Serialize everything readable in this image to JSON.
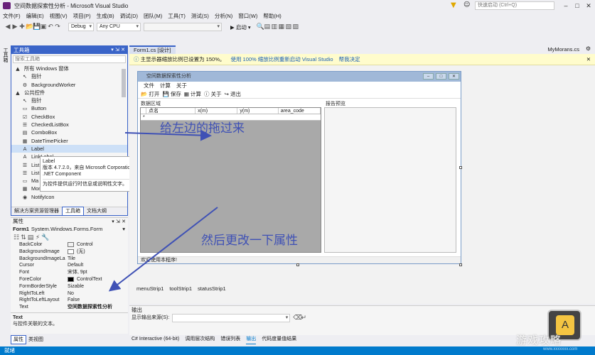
{
  "window": {
    "title": "空间数据探索性分析 - Microsoft Visual Studio",
    "quick_launch_placeholder": "快速启动 (Ctrl+Q)",
    "user": "MyMorans.cs"
  },
  "menu": [
    "文件(F)",
    "编辑(E)",
    "视图(V)",
    "项目(P)",
    "生成(B)",
    "调试(D)",
    "团队(M)",
    "工具(T)",
    "测试(S)",
    "分析(N)",
    "窗口(W)",
    "帮助(H)"
  ],
  "toolbar": {
    "config": "Debug",
    "platform": "Any CPU",
    "start_label": "▶ 启动 ▾"
  },
  "side_strip": "工具箱",
  "toolbox": {
    "title": "工具箱",
    "search_placeholder": "搜索工具箱",
    "rows": [
      {
        "text": "所有 Windows 窗体",
        "type": "group",
        "icon": "▲"
      },
      {
        "text": "指针",
        "type": "item",
        "icon": "↖"
      },
      {
        "text": "BackgroundWorker",
        "type": "item",
        "icon": "⚙"
      },
      {
        "text": "公共控件",
        "type": "group",
        "icon": "▲"
      },
      {
        "text": "指针",
        "type": "item",
        "icon": "↖"
      },
      {
        "text": "Button",
        "type": "item",
        "icon": "▭"
      },
      {
        "text": "CheckBox",
        "type": "item",
        "icon": "☑"
      },
      {
        "text": "CheckedListBox",
        "type": "item",
        "icon": "☰"
      },
      {
        "text": "ComboBox",
        "type": "item",
        "icon": "▤"
      },
      {
        "text": "DateTimePicker",
        "type": "item",
        "icon": "▦"
      },
      {
        "text": "Label",
        "type": "item",
        "icon": "A",
        "selected": true
      },
      {
        "text": "LinkLabel",
        "type": "item",
        "icon": "A"
      },
      {
        "text": "List",
        "type": "item",
        "icon": "☰"
      },
      {
        "text": "List",
        "type": "item",
        "icon": "☰"
      },
      {
        "text": "Ma",
        "type": "item",
        "icon": "▭"
      },
      {
        "text": "MonthCalendar",
        "type": "item",
        "icon": "▦"
      },
      {
        "text": "NotifyIcon",
        "type": "item",
        "icon": "◉"
      }
    ],
    "tabs": [
      "解决方案资源管理器",
      "工具箱",
      "文档大纲"
    ]
  },
  "tooltip": {
    "title": "Label",
    "line1": "版本 4.7.2.0，来自 Microsoft Corporation",
    "line2": ".NET Component",
    "desc": "为控件提供运行时信息或说明性文字。"
  },
  "properties": {
    "header": "属性",
    "object": "Form1",
    "object_type": "System.Windows.Forms.Form",
    "rows": [
      {
        "k": "BackColor",
        "v": "Control",
        "swatch": "#f0f0f0"
      },
      {
        "k": "BackgroundImage",
        "v": "(无)",
        "swatch": "#ffffff"
      },
      {
        "k": "BackgroundImageLa",
        "v": "Tile"
      },
      {
        "k": "Cursor",
        "v": "Default"
      },
      {
        "k": "Font",
        "v": "宋体, 9pt"
      },
      {
        "k": "ForeColor",
        "v": "ControlText",
        "swatch": "#000000"
      },
      {
        "k": "FormBorderStyle",
        "v": "Sizable"
      },
      {
        "k": "RightToLeft",
        "v": "No"
      },
      {
        "k": "RightToLeftLayout",
        "v": "False"
      },
      {
        "k": "Text",
        "v": "空间数据探索性分析"
      }
    ],
    "desc_title": "Text",
    "desc": "与控件关联的文本。",
    "tabs": [
      "属性",
      "类视图"
    ]
  },
  "doc_tab": "Form1.cs [设计]",
  "infobar": {
    "message": "主显示器缩放比例已设置为 150%。",
    "link1": "使用 100% 缩放比例重新启动 Visual Studio",
    "link2": "帮我决定"
  },
  "form": {
    "title": "空间数据探索性分析",
    "menu": [
      "文件",
      "计算",
      "关于"
    ],
    "toolbar": [
      "📂 打开",
      "💾 保存",
      "▦ 计算",
      "ⓘ 关于",
      "↪ 退出"
    ],
    "data_group": "数据区域",
    "report_group": "报告预览",
    "columns": [
      "点名",
      "x(m)",
      "y(m)",
      "area_code"
    ],
    "new_row": "*",
    "status": "欢迎使用本程序!"
  },
  "tray": [
    "menuStrip1",
    "toolStrip1",
    "statusStrip1"
  ],
  "output": {
    "title": "输出",
    "source_label": "显示输出来源(S):"
  },
  "bottom_tabs": [
    "C# Interactive (64-bit)",
    "调用层次结构",
    "错误列表",
    "输出",
    "代码度量值结果"
  ],
  "status": "就绪",
  "annotations": {
    "a1": "给左边的拖过来",
    "a2": "然后更改一下属性"
  },
  "watermark": {
    "badge": "A",
    "text": "游戏攻略",
    "url": "www.xxxxxxx.com"
  },
  "colors": {
    "accent": "#007acc",
    "panel_border": "#3a64c8",
    "annotation": "#3f51b5",
    "grid_bg": "#a9a9a9"
  }
}
